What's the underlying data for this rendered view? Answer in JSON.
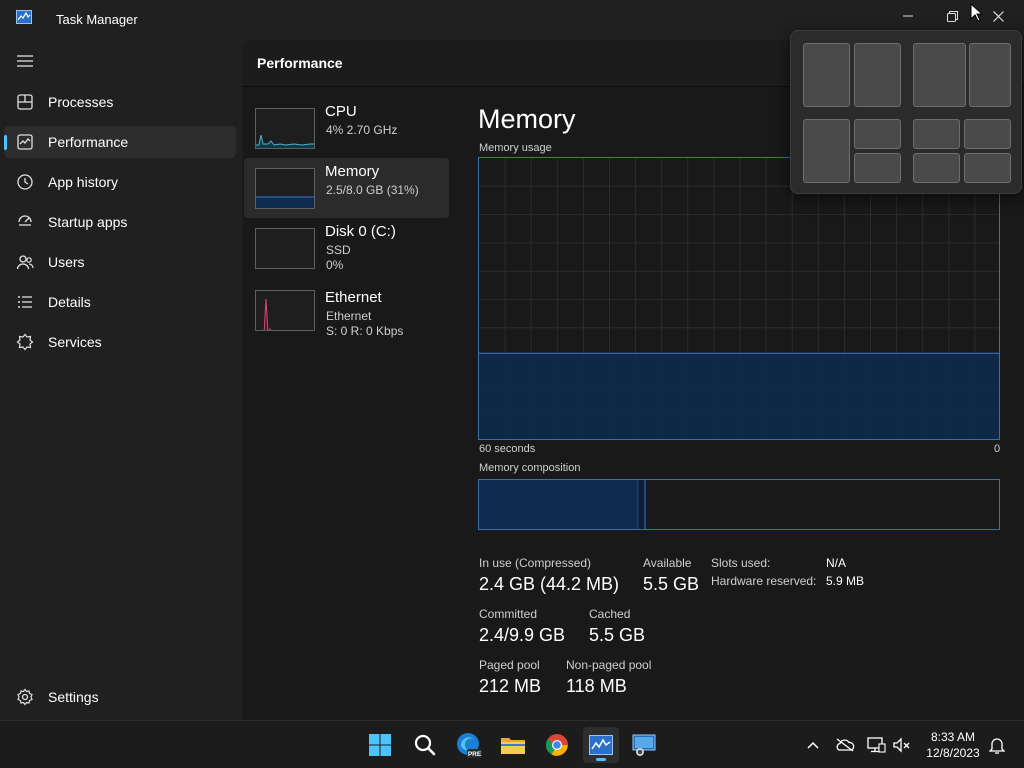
{
  "window": {
    "title": "Task Manager",
    "app_icon": "task-manager-icon"
  },
  "window_controls": {
    "minimize": "minimize-icon",
    "restore": "restore-icon",
    "close": "close-icon"
  },
  "sidebar": {
    "menu_icon": "hamburger-menu-icon",
    "items": [
      {
        "label": "Processes",
        "icon": "processes-icon",
        "selected": false
      },
      {
        "label": "Performance",
        "icon": "performance-icon",
        "selected": true
      },
      {
        "label": "App history",
        "icon": "app-history-icon",
        "selected": false
      },
      {
        "label": "Startup apps",
        "icon": "startup-apps-icon",
        "selected": false
      },
      {
        "label": "Users",
        "icon": "users-icon",
        "selected": false
      },
      {
        "label": "Details",
        "icon": "details-icon",
        "selected": false
      },
      {
        "label": "Services",
        "icon": "services-icon",
        "selected": false
      }
    ],
    "settings": {
      "label": "Settings",
      "icon": "settings-gear-icon"
    }
  },
  "content": {
    "title": "Performance"
  },
  "perf_list": [
    {
      "name": "CPU",
      "line1": "4% 2.70 GHz",
      "line2": "",
      "selected": false,
      "color": "#4cb3c9"
    },
    {
      "name": "Memory",
      "line1": "2.5/8.0 GB (31%)",
      "line2": "",
      "selected": true,
      "color": "#3d78c9"
    },
    {
      "name": "Disk 0 (C:)",
      "line1": "SSD",
      "line2": "0%",
      "selected": false,
      "color": "#6aa84f"
    },
    {
      "name": "Ethernet",
      "line1": "Ethernet",
      "line2": "S: 0 R: 0 Kbps",
      "selected": false,
      "color": "#d9477a"
    }
  ],
  "memory": {
    "title": "Memory",
    "usage_label": "Memory usage",
    "time_label": "60 seconds",
    "zero_label": "0",
    "composition_label": "Memory composition",
    "usage_percent": 31,
    "composition": {
      "in_use_percent": 30.5,
      "modified_percent": 1.3
    },
    "stats": {
      "in_use_label": "In use (Compressed)",
      "in_use_value": "2.4 GB (44.2 MB)",
      "available_label": "Available",
      "available_value": "5.5 GB",
      "slots_label": "Slots used:",
      "slots_value": "N/A",
      "hw_reserved_label": "Hardware reserved:",
      "hw_reserved_value": "5.9 MB",
      "committed_label": "Committed",
      "committed_value": "2.4/9.9 GB",
      "cached_label": "Cached",
      "cached_value": "5.5 GB",
      "paged_label": "Paged pool",
      "paged_value": "212 MB",
      "nonpaged_label": "Non-paged pool",
      "nonpaged_value": "118 MB"
    }
  },
  "snap_layouts": {
    "layouts": [
      "two-column-equal",
      "two-column-wide-left",
      "three-grid-left-tall",
      "four-grid"
    ]
  },
  "taskbar": {
    "apps": [
      {
        "name": "start-button",
        "icon": "windows-logo-icon",
        "active": false
      },
      {
        "name": "search-button",
        "icon": "search-icon",
        "active": false
      },
      {
        "name": "edge-preview-button",
        "icon": "edge-pre-icon",
        "active": false,
        "badge": "PRE"
      },
      {
        "name": "file-explorer-button",
        "icon": "folder-icon",
        "active": false
      },
      {
        "name": "chrome-button",
        "icon": "chrome-icon",
        "active": false
      },
      {
        "name": "task-manager-taskbar-button",
        "icon": "task-manager-icon",
        "active": true
      },
      {
        "name": "remote-desktop-button",
        "icon": "remote-desktop-icon",
        "active": false
      }
    ],
    "tray": [
      "chevron-up-icon",
      "onedrive-icon",
      "network-icon",
      "speaker-muted-icon"
    ],
    "clock": {
      "time": "8:33 AM",
      "date": "12/8/2023"
    },
    "notifications_icon": "bell-icon"
  }
}
